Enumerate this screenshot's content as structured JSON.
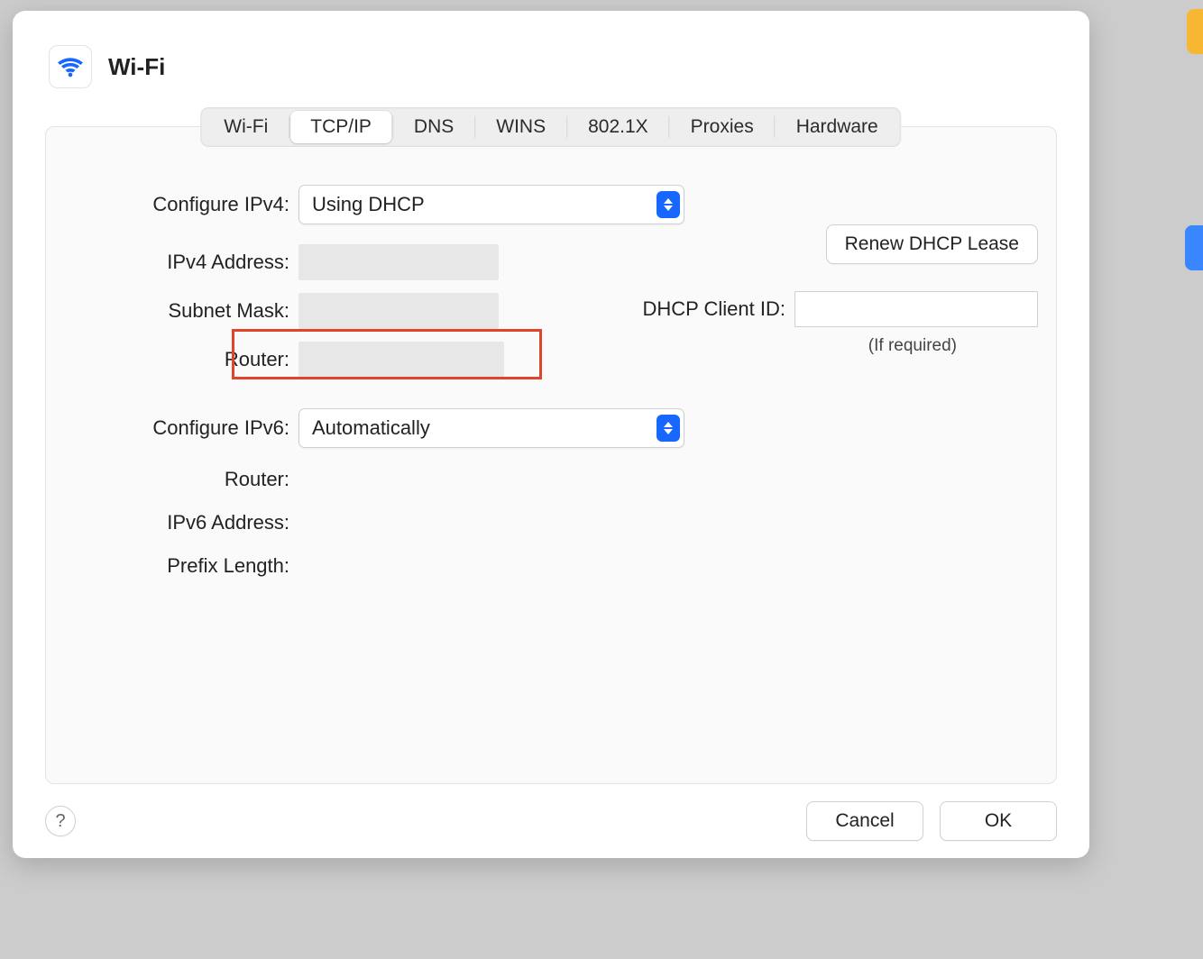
{
  "header": {
    "title": "Wi-Fi",
    "icon": "wifi-icon",
    "icon_color": "#1767ff"
  },
  "tabs": [
    {
      "label": "Wi-Fi",
      "active": false
    },
    {
      "label": "TCP/IP",
      "active": true
    },
    {
      "label": "DNS",
      "active": false
    },
    {
      "label": "WINS",
      "active": false
    },
    {
      "label": "802.1X",
      "active": false
    },
    {
      "label": "Proxies",
      "active": false
    },
    {
      "label": "Hardware",
      "active": false
    }
  ],
  "ipv4": {
    "configure_label": "Configure IPv4:",
    "configure_value": "Using DHCP",
    "address_label": "IPv4 Address:",
    "address_value": "",
    "subnet_label": "Subnet Mask:",
    "subnet_value": "",
    "router_label": "Router:",
    "router_value": "",
    "highlight_router": true
  },
  "dhcp": {
    "renew_label": "Renew DHCP Lease",
    "client_id_label": "DHCP Client ID:",
    "client_id_value": "",
    "hint": "(If required)"
  },
  "ipv6": {
    "configure_label": "Configure IPv6:",
    "configure_value": "Automatically",
    "router_label": "Router:",
    "router_value": "",
    "address_label": "IPv6 Address:",
    "address_value": "",
    "prefix_label": "Prefix Length:",
    "prefix_value": ""
  },
  "footer": {
    "help_label": "?",
    "cancel_label": "Cancel",
    "ok_label": "OK"
  }
}
